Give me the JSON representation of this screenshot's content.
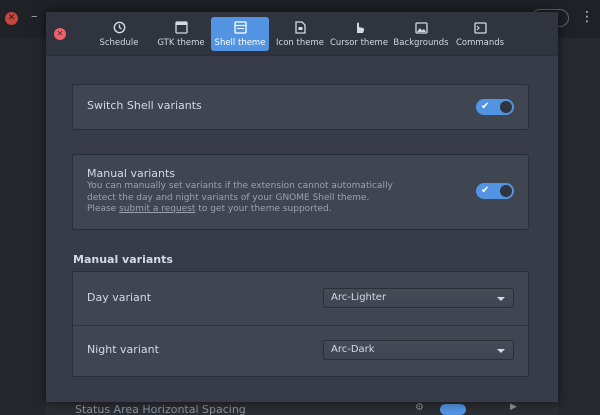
{
  "background": {
    "bottom_label": "Status Area Horizontal Spacing"
  },
  "tabs": [
    {
      "label": "Schedule",
      "icon": "clock-icon",
      "active": false
    },
    {
      "label": "GTK theme",
      "icon": "window-icon",
      "active": false
    },
    {
      "label": "Shell theme",
      "icon": "shell-window-icon",
      "active": true
    },
    {
      "label": "Icon theme",
      "icon": "document-icon",
      "active": false
    },
    {
      "label": "Cursor theme",
      "icon": "cursor-hand-icon",
      "active": false
    },
    {
      "label": "Backgrounds",
      "icon": "image-icon",
      "active": false
    },
    {
      "label": "Commands",
      "icon": "terminal-icon",
      "active": false
    }
  ],
  "switch_variants": {
    "label": "Switch Shell variants",
    "enabled": true
  },
  "manual_variants_toggle": {
    "label": "Manual variants",
    "description_line1": "You can manually set variants if the extension cannot automatically",
    "description_line2": "detect the day and night variants of your GNOME Shell theme.",
    "description_line3_prefix": "Please ",
    "link_text": "submit a request",
    "description_line3_suffix": " to get your theme supported.",
    "enabled": true
  },
  "manual_variants_section": {
    "title": "Manual variants",
    "day_label": "Day variant",
    "day_value": "Arc-Lighter",
    "night_label": "Night variant",
    "night_value": "Arc-Dark"
  },
  "colors": {
    "accent": "#5294e2",
    "dialog_bg": "#383c4a",
    "card_bg": "#404552",
    "close": "#f46067"
  }
}
